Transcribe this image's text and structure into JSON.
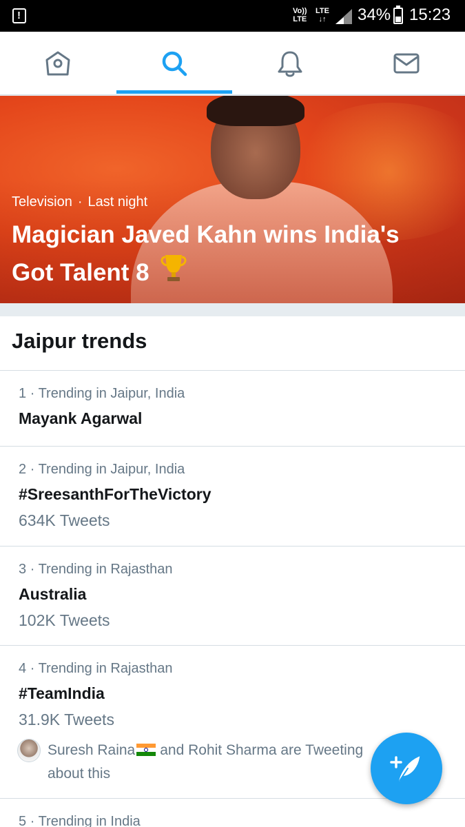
{
  "status_bar": {
    "alert_icon": "alert-icon",
    "volte_label": "Vo)) LTE",
    "lte_label": "LTE",
    "battery_percent": "34%",
    "battery_level": 0.34,
    "time": "15:23"
  },
  "nav": {
    "tabs": [
      {
        "name": "home",
        "icon": "home-icon",
        "active": false
      },
      {
        "name": "search",
        "icon": "search-icon",
        "active": true
      },
      {
        "name": "notifications",
        "icon": "bell-icon",
        "active": false
      },
      {
        "name": "messages",
        "icon": "mail-icon",
        "active": false
      }
    ],
    "active_color": "#1da1f2",
    "inactive_color": "#657786"
  },
  "hero": {
    "category": "Television",
    "separator": "·",
    "time": "Last night",
    "title": "Magician Javed Kahn wins India's Got Talent 8",
    "emoji_icon": "trophy-icon"
  },
  "trends": {
    "title": "Jaipur trends",
    "items": [
      {
        "rank": "1",
        "separator": "·",
        "context": "Trending in Jaipur, India",
        "name": "Mayank Agarwal",
        "count": ""
      },
      {
        "rank": "2",
        "separator": "·",
        "context": "Trending in Jaipur, India",
        "name": "#SreesanthForTheVictory",
        "count": "634K Tweets"
      },
      {
        "rank": "3",
        "separator": "·",
        "context": "Trending in Rajasthan",
        "name": "Australia",
        "count": "102K Tweets"
      },
      {
        "rank": "4",
        "separator": "·",
        "context": "Trending in Rajasthan",
        "name": "#TeamIndia",
        "count": "31.9K Tweets",
        "social_pre": "Suresh Raina",
        "social_post": "and Rohit Sharma are Tweeting about this"
      },
      {
        "rank": "5",
        "separator": "·",
        "context": "Trending in India",
        "name": "",
        "count": ""
      }
    ]
  },
  "fab": {
    "icon": "compose-tweet-icon"
  }
}
